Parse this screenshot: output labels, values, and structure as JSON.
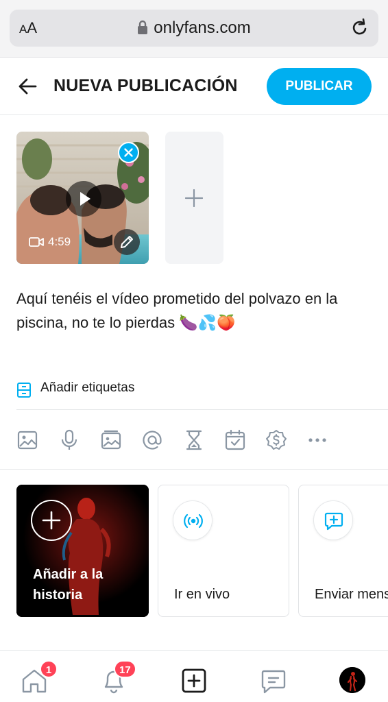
{
  "browser": {
    "text_size_label": "AA",
    "url": "onlyfans.com"
  },
  "header": {
    "title": "NUEVA PUBLICACIÓN",
    "publish_label": "PUBLICAR"
  },
  "media": {
    "items": [
      {
        "type": "video",
        "duration": "4:59"
      }
    ]
  },
  "post": {
    "caption": "Aquí tenéis el vídeo prometido del polvazo en la piscina, no te lo pierdas 🍆💦🍑"
  },
  "tags": {
    "label": "Añadir etiquetas"
  },
  "toolbar": {
    "tools": [
      "image-icon",
      "microphone-icon",
      "gallery-icon",
      "mention-icon",
      "hourglass-icon",
      "calendar-icon",
      "price-icon",
      "more-icon"
    ]
  },
  "cards": {
    "story_label": "Añadir a la historia",
    "live_label": "Ir en vivo",
    "message_label": "Enviar mensaje"
  },
  "bottom_nav": {
    "home_badge": "1",
    "notifications_badge": "17"
  },
  "colors": {
    "accent": "#00aff0",
    "badge": "#ff4257",
    "icon_gray": "#8a96a3"
  }
}
